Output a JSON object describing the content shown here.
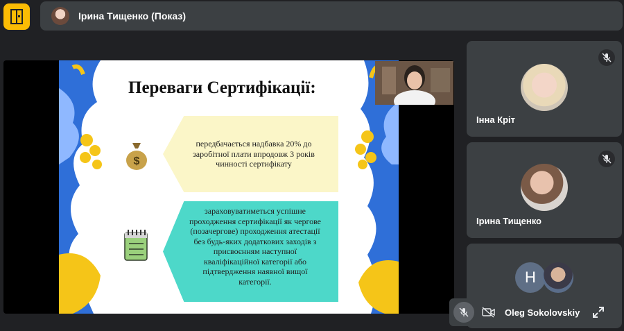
{
  "presenter": {
    "name": "Ірина Тищенко (Показ)"
  },
  "slide": {
    "title": "Переваги Сертифікації:",
    "block1": [
      "передбачається надбавка 20% до",
      "заробітної плати впродовж 3 років",
      "чинності сертифікату"
    ],
    "block2": [
      "зараховуватиметься успішне",
      "проходження сертифікації як чергове",
      "(позачергове) проходження атестації",
      "без будь-яких додаткових заходів з",
      "присвоєнням наступної",
      "кваліфікаційної категорії або",
      "підтвердження наявної вищої",
      "категорії."
    ],
    "money_symbol": "$"
  },
  "participants": [
    {
      "name": "Інна Кріт",
      "muted": true
    },
    {
      "name": "Ірина Тищенко",
      "muted": true
    },
    {
      "initial": "H"
    }
  ],
  "self_view": {
    "name": "Oleg Sokolovskiy"
  },
  "colors": {
    "background": "#202124",
    "tile": "#3c4043",
    "accent": "#fbbc04",
    "slide_box_yellow": "#fbf6c8",
    "slide_box_teal": "#4dd8c9",
    "avatar_h": "#5f6f86"
  },
  "icons": [
    "meeting-details-icon",
    "mic-off-icon",
    "camera-off-icon",
    "expand-icon",
    "money-bag-icon",
    "calendar-icon"
  ]
}
